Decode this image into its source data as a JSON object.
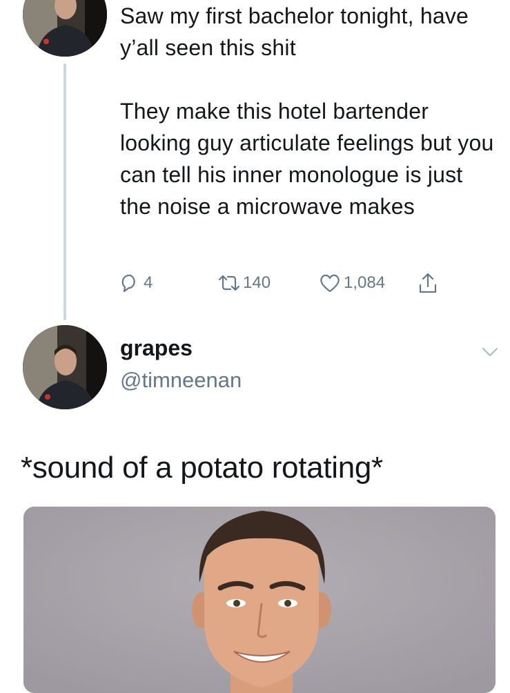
{
  "first_tweet": {
    "paragraphs": [
      "Saw my first bachelor tonight, have y’all seen this shit",
      "They make this hotel bartender looking guy articulate feelings but you can tell his inner monologue is just the noise a microwave makes"
    ],
    "actions": {
      "replies": "4",
      "retweets": "140",
      "likes": "1,084"
    }
  },
  "second_tweet": {
    "name": "grapes",
    "handle": "@timneenan",
    "text": "*sound of a potato rotating*"
  },
  "icons": {
    "reply": "speech-bubble-icon",
    "retweet": "retweet-arrows-icon",
    "like": "heart-icon",
    "share": "share-upload-icon",
    "menu": "chevron-down-icon"
  },
  "colors": {
    "text": "#14171a",
    "secondary": "#657786",
    "thread_line": "#ccd6dd"
  }
}
